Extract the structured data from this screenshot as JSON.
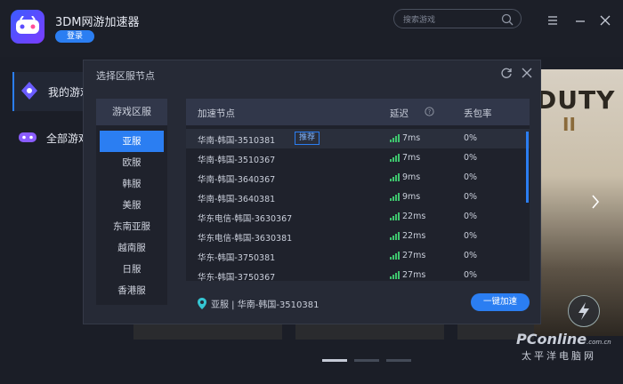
{
  "app": {
    "title": "3DM网游加速器",
    "login_label": "登录"
  },
  "search": {
    "placeholder": "搜索游戏"
  },
  "sidebar": {
    "items": [
      {
        "label": "我的游戏"
      },
      {
        "label": "全部游戏"
      }
    ]
  },
  "banner": {
    "text_a": "DUTY",
    "text_b": "II"
  },
  "modal": {
    "title": "选择区服节点",
    "regions_header": "游戏区服",
    "regions": [
      "亚服",
      "欧服",
      "韩服",
      "美服",
      "东南亚服",
      "越南服",
      "日服",
      "香港服"
    ],
    "columns": {
      "node": "加速节点",
      "latency": "延迟",
      "loss": "丢包率"
    },
    "nodes": [
      {
        "name": "华南-韩国-3510381",
        "tag": "推荐",
        "latency": "7ms",
        "loss": "0%"
      },
      {
        "name": "华南-韩国-3510367",
        "latency": "7ms",
        "loss": "0%"
      },
      {
        "name": "华南-韩国-3640367",
        "latency": "9ms",
        "loss": "0%"
      },
      {
        "name": "华南-韩国-3640381",
        "latency": "9ms",
        "loss": "0%"
      },
      {
        "name": "华东电信-韩国-3630367",
        "latency": "22ms",
        "loss": "0%"
      },
      {
        "name": "华东电信-韩国-3630381",
        "latency": "22ms",
        "loss": "0%"
      },
      {
        "name": "华东-韩国-3750381",
        "latency": "27ms",
        "loss": "0%"
      },
      {
        "name": "华东-韩国-3750367",
        "latency": "27ms",
        "loss": "0%"
      }
    ],
    "selected_location": "亚服 | 华南-韩国-3510381",
    "accelerate_label": "一键加速"
  },
  "watermark": {
    "brand": "PConline",
    "domain": ".com.cn",
    "cn": "太平洋电脑网"
  },
  "colors": {
    "accent": "#2b7ef2",
    "bg": "#1b1e27",
    "signal": "#3ec46d"
  }
}
